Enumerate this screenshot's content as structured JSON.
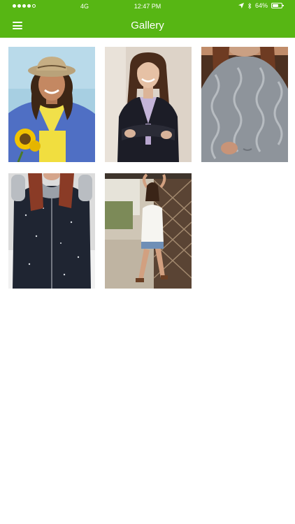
{
  "status_bar": {
    "carrier": "4G",
    "time": "12:47 PM",
    "battery": "64%",
    "icons": [
      "signal-dots-icon",
      "location-arrow-icon",
      "bluetooth-icon",
      "battery-icon"
    ]
  },
  "navbar": {
    "title": "Gallery",
    "menu_icon": "hamburger-menu-icon"
  },
  "theme": {
    "accent": "#57b614",
    "background": "#ffffff"
  },
  "gallery": {
    "photos": [
      {
        "name": "photo-cowboy-hat-sunflower"
      },
      {
        "name": "photo-black-blazer"
      },
      {
        "name": "photo-knit-sweater"
      },
      {
        "name": "photo-winter-coat"
      },
      {
        "name": "photo-white-top-fence"
      }
    ]
  }
}
